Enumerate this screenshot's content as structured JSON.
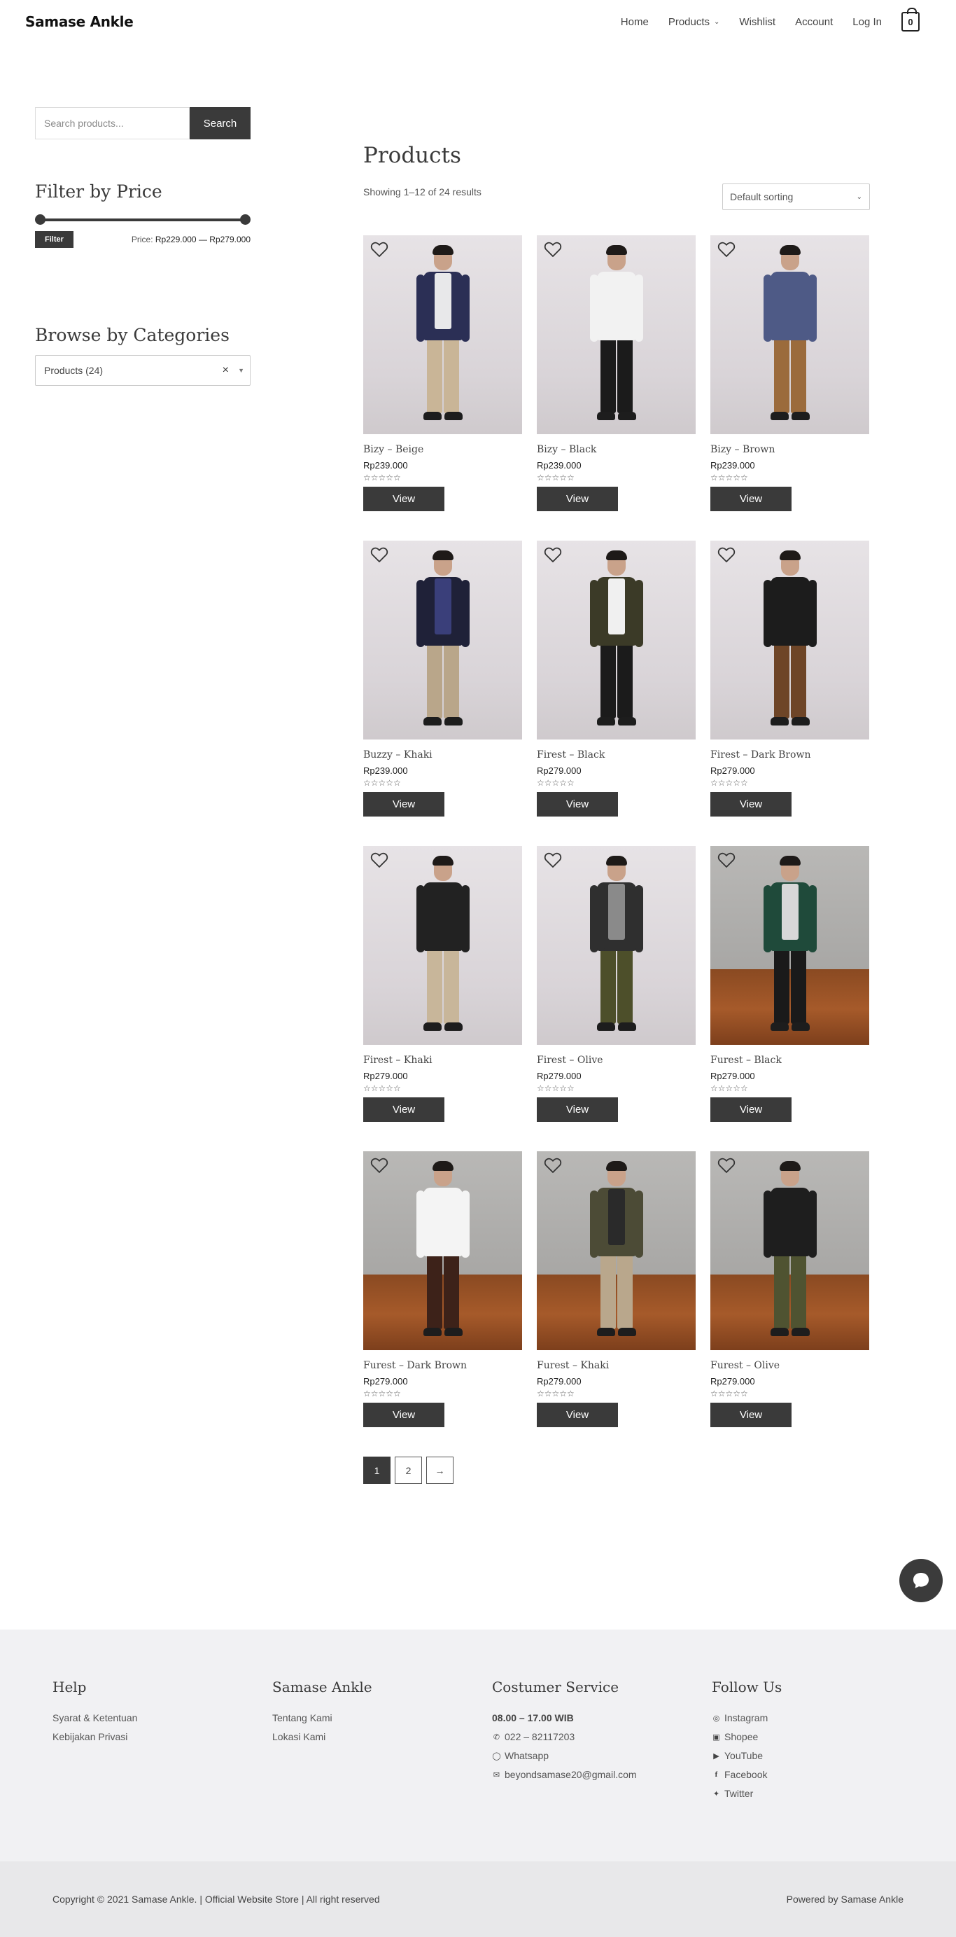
{
  "header": {
    "logo": "Samase Ankle",
    "nav": [
      "Home",
      "Products",
      "Wishlist",
      "Account",
      "Log In"
    ],
    "cart_count": "0"
  },
  "sidebar": {
    "search_placeholder": "Search products...",
    "search_button": "Search",
    "price_title": "Filter by Price",
    "filter_button": "Filter",
    "price_prefix": "Price:",
    "price_range": "Rp229.000 — Rp279.000",
    "categories_title": "Browse by Categories",
    "category_selected": "Products  (24)",
    "clear_glyph": "×"
  },
  "main": {
    "title": "Products",
    "result_count": "Showing 1–12 of 24 results",
    "sort_value": "Default sorting",
    "view_label": "View",
    "stars": "☆☆☆☆☆",
    "products": [
      {
        "name": "Bizy – Beige",
        "price": "Rp239.000"
      },
      {
        "name": "Bizy – Black",
        "price": "Rp239.000"
      },
      {
        "name": "Bizy – Brown",
        "price": "Rp239.000"
      },
      {
        "name": "Buzzy – Khaki",
        "price": "Rp239.000"
      },
      {
        "name": "Firest – Black",
        "price": "Rp279.000"
      },
      {
        "name": "Firest – Dark Brown",
        "price": "Rp279.000"
      },
      {
        "name": "Firest – Khaki",
        "price": "Rp279.000"
      },
      {
        "name": "Firest – Olive",
        "price": "Rp279.000"
      },
      {
        "name": "Furest – Black",
        "price": "Rp279.000"
      },
      {
        "name": "Furest – Dark Brown",
        "price": "Rp279.000"
      },
      {
        "name": "Furest – Khaki",
        "price": "Rp279.000"
      },
      {
        "name": "Furest – Olive",
        "price": "Rp279.000"
      }
    ],
    "pagination": [
      "1",
      "2",
      "→"
    ]
  },
  "footer": {
    "help_title": "Help",
    "help_links": [
      "Syarat & Ketentuan",
      "Kebijakan Privasi"
    ],
    "brand_title": "Samase Ankle",
    "brand_links": [
      "Tentang Kami",
      "Lokasi Kami"
    ],
    "cs_title": "Costumer Service",
    "cs_hours": "08.00 – 17.00 WIB",
    "cs_phone": "022 – 82117203",
    "cs_whatsapp": "Whatsapp",
    "cs_email": "beyondsamase20@gmail.com",
    "follow_title": "Follow Us",
    "follow_links": [
      "Instagram",
      "Shopee",
      "YouTube",
      "Facebook",
      "Twitter"
    ],
    "copyright": "Copyright © 2021 Samase Ankle. | Official Website Store | All right reserved",
    "powered": "Powered by Samase Ankle"
  },
  "colors": {
    "accent_dark": "#3a3a3a",
    "footer_bg": "#f1f1f3",
    "bottom_bar_bg": "#e8e8ea"
  }
}
